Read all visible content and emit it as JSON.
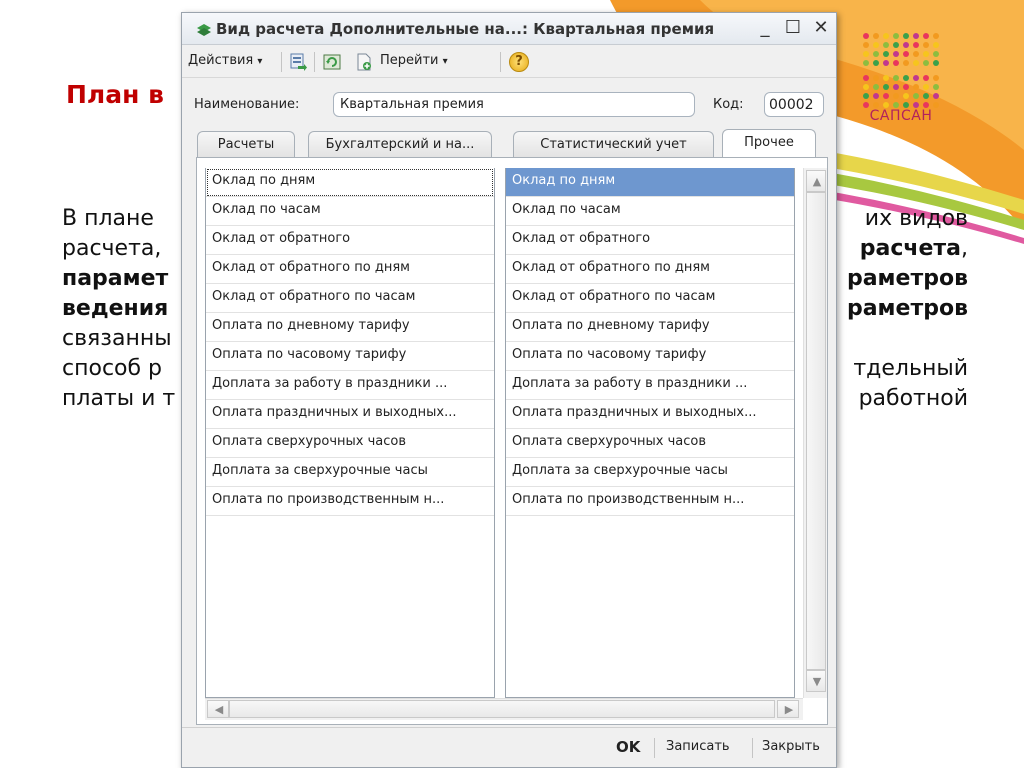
{
  "slide": {
    "title": "План в",
    "logo_text": "САПСАН",
    "body_lines": [
      {
        "parts": [
          {
            "text": "В плане",
            "bold": false
          }
        ]
      },
      {
        "parts": [
          {
            "text": "расчета,",
            "bold": false
          }
        ]
      },
      {
        "parts": [
          {
            "text": "парамет",
            "bold": true
          }
        ]
      },
      {
        "parts": [
          {
            "text": "ведения",
            "bold": true
          }
        ]
      },
      {
        "parts": [
          {
            "text": "связанны",
            "bold": false
          }
        ]
      },
      {
        "parts": [
          {
            "text": "способ р",
            "bold": false
          }
        ]
      },
      {
        "parts": [
          {
            "text": "платы и т",
            "bold": false
          }
        ]
      }
    ],
    "body_lines_right": [
      {
        "parts": [
          {
            "text": "их видов",
            "bold": false
          }
        ]
      },
      {
        "parts": [
          {
            "text": "расчета",
            "bold": true
          },
          {
            "text": ",",
            "bold": false
          }
        ]
      },
      {
        "parts": [
          {
            "text": "раметров",
            "bold": true
          }
        ]
      },
      {
        "parts": [
          {
            "text": "раметров",
            "bold": true
          }
        ]
      },
      {
        "parts": [
          {
            "text": "тдельный",
            "bold": false
          }
        ]
      },
      {
        "parts": [
          {
            "text": "работной",
            "bold": false
          }
        ]
      }
    ]
  },
  "window": {
    "title": "Вид расчета Дополнительные на...: Квартальная премия",
    "controls": {
      "minimize": "_",
      "maximize": "☐",
      "close": "✕"
    },
    "toolbar": {
      "actions_label": "Действия",
      "goto_label": "Перейти",
      "dropdown_arrow": "▾",
      "help_symbol": "?"
    },
    "form": {
      "name_label": "Наименование:",
      "name_value": "Квартальная премия",
      "code_label": "Код:",
      "code_value": "00002"
    },
    "tabs": [
      {
        "label": "Расчеты"
      },
      {
        "label": "Бухгалтерский и на..."
      },
      {
        "label": "Статистический учет"
      },
      {
        "label": "Прочее"
      }
    ],
    "left_list": [
      "Оклад по дням",
      "Оклад по часам",
      "Оклад от обратного",
      "Оклад от обратного по дням",
      "Оклад от обратного по часам",
      "Оплата по дневному тарифу",
      "Оплата по часовому тарифу",
      "Доплата за работу в праздники ...",
      "Оплата праздничных и выходных...",
      "Оплата сверхурочных часов",
      "Доплата за сверхурочные часы",
      "Оплата по производственным н..."
    ],
    "right_list": [
      "Оклад по дням",
      "Оклад по часам",
      "Оклад от обратного",
      "Оклад от обратного по дням",
      "Оклад от обратного по часам",
      "Оплата по дневному тарифу",
      "Оплата по часовому тарифу",
      "Доплата за работу в праздники ...",
      "Оплата праздничных и выходных...",
      "Оплата сверхурочных часов",
      "Доплата за сверхурочные часы",
      "Оплата по производственным н..."
    ],
    "scroll": {
      "up": "▲",
      "down": "▼",
      "left": "◀",
      "right": "▶"
    },
    "bottom": {
      "ok": "OK",
      "save": "Записать",
      "close": "Закрыть"
    },
    "colors": {
      "selection": "#6e97cf",
      "icon_green": "#3a9a46"
    }
  }
}
